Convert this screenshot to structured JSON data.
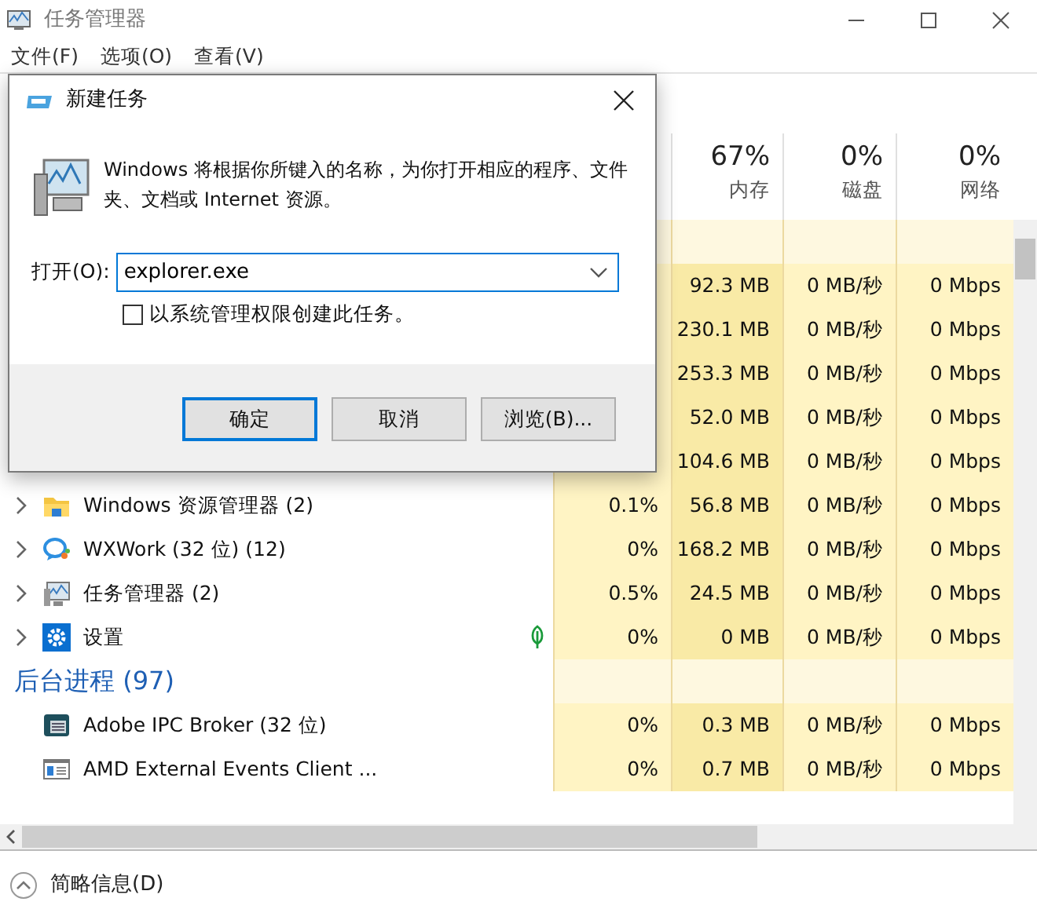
{
  "window": {
    "title": "任务管理器"
  },
  "menu": [
    {
      "label": "文件(F)"
    },
    {
      "label": "选项(O)"
    },
    {
      "label": "查看(V)"
    }
  ],
  "columns": [
    {
      "percent": "67%",
      "label": "内存"
    },
    {
      "percent": "0%",
      "label": "磁盘"
    },
    {
      "percent": "0%",
      "label": "网络"
    }
  ],
  "rows": [
    {
      "kind": "group"
    },
    {
      "kind": "app",
      "memory": "92.3 MB",
      "disk": "0 MB/秒",
      "network": "0 Mbps"
    },
    {
      "kind": "app",
      "memory": "230.1 MB",
      "disk": "0 MB/秒",
      "network": "0 Mbps"
    },
    {
      "kind": "app",
      "memory": "253.3 MB",
      "disk": "0 MB/秒",
      "network": "0 Mbps"
    },
    {
      "kind": "app",
      "memory": "52.0 MB",
      "disk": "0 MB/秒",
      "network": "0 Mbps"
    },
    {
      "kind": "app",
      "memory": "104.6 MB",
      "disk": "0 MB/秒",
      "network": "0 Mbps"
    },
    {
      "kind": "app",
      "name": "Windows 资源管理器 (2)",
      "expanded": false,
      "paused": false,
      "cpu": "0.1%",
      "memory": "56.8 MB",
      "disk": "0 MB/秒",
      "network": "0 Mbps"
    },
    {
      "kind": "app",
      "name": "WXWork (32 位) (12)",
      "expanded": false,
      "paused": false,
      "cpu": "0%",
      "memory": "168.2 MB",
      "disk": "0 MB/秒",
      "network": "0 Mbps"
    },
    {
      "kind": "app",
      "name": "任务管理器 (2)",
      "expanded": false,
      "paused": false,
      "cpu": "0.5%",
      "memory": "24.5 MB",
      "disk": "0 MB/秒",
      "network": "0 Mbps"
    },
    {
      "kind": "app",
      "name": "设置",
      "expanded": false,
      "paused": true,
      "cpu": "0%",
      "memory": "0 MB",
      "disk": "0 MB/秒",
      "network": "0 Mbps"
    },
    {
      "kind": "group",
      "name": "后台进程 (97)"
    },
    {
      "kind": "process",
      "name": "Adobe IPC Broker (32 位)",
      "cpu": "0%",
      "memory": "0.3 MB",
      "disk": "0 MB/秒",
      "network": "0 Mbps"
    },
    {
      "kind": "process",
      "name": "AMD External Events Client ...",
      "cpu": "0%",
      "memory": "0.7 MB",
      "disk": "0 MB/秒",
      "network": "0 Mbps"
    }
  ],
  "footer": {
    "label": "简略信息(D)"
  },
  "dialog": {
    "title": "新建任务",
    "message": "Windows 将根据你所键入的名称，为你打开相应的程序、文件夹、文档或 Internet 资源。",
    "open_label": "打开(O):",
    "command": "explorer.exe",
    "admin_checkbox": {
      "label": "以系统管理权限创建此任务。",
      "checked": false
    },
    "buttons": [
      {
        "label": "确定",
        "default": true
      },
      {
        "label": "取消",
        "default": false
      },
      {
        "label": "浏览(B)...",
        "default": false
      }
    ]
  }
}
